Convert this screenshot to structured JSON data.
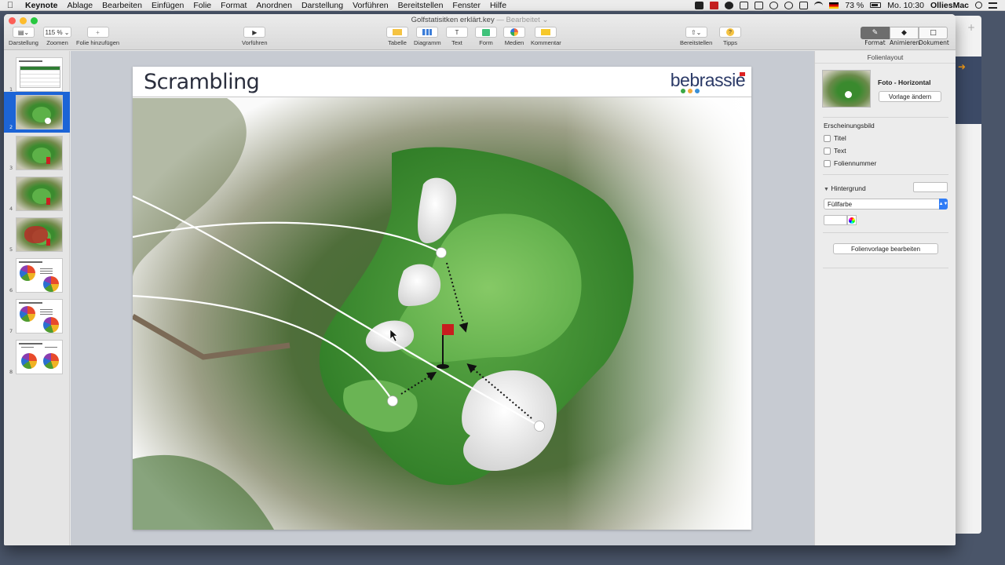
{
  "menubar": {
    "apple": "",
    "items": [
      "Keynote",
      "Ablage",
      "Bearbeiten",
      "Einfügen",
      "Folie",
      "Format",
      "Anordnen",
      "Darstellung",
      "Vorführen",
      "Bereitstellen",
      "Fenster",
      "Hilfe"
    ],
    "battery": "73 %",
    "clock": "Mo. 10:30",
    "user": "OlliesMac",
    "icons": [
      "dropbox-icon",
      "adobe-icon",
      "creative-cloud-icon",
      "cloud-upload-icon",
      "airplay-icon",
      "time-machine-icon",
      "sync-icon",
      "screen-icon",
      "wifi-icon",
      "flag-de-icon",
      "battery-icon",
      "search-icon",
      "list-icon"
    ]
  },
  "window": {
    "title": "Golfstatisitken erklärt.key",
    "status": "— Bearbeitet ⌄"
  },
  "toolbar": {
    "view": {
      "label": "Darstellung",
      "icon": "view-sidebar-icon"
    },
    "zoom": {
      "label": "Zoomen",
      "value": "115 %"
    },
    "add_slide": {
      "label": "Folie hinzufügen",
      "icon": "plus-icon"
    },
    "play": {
      "label": "Vorführen",
      "icon": "play-icon"
    },
    "insert": [
      {
        "label": "Tabelle",
        "icon": "table-icon",
        "color": "#f5c342"
      },
      {
        "label": "Diagramm",
        "icon": "chart-icon",
        "color": "#3b7dd8"
      },
      {
        "label": "Text",
        "icon": "text-icon",
        "glyph": "T"
      },
      {
        "label": "Form",
        "icon": "shape-icon",
        "color": "#3fc27a"
      },
      {
        "label": "Medien",
        "icon": "media-icon"
      },
      {
        "label": "Kommentar",
        "icon": "comment-icon",
        "color": "#f6c82b"
      }
    ],
    "share": {
      "label": "Bereitstellen",
      "icon": "share-icon"
    },
    "tips": {
      "label": "Tipps",
      "icon": "tips-icon",
      "glyph": "?"
    },
    "segments": [
      {
        "label": "Format",
        "icon": "paintbrush-icon",
        "active": true
      },
      {
        "label": "Animieren",
        "icon": "animate-icon",
        "active": false
      },
      {
        "label": "Dokument",
        "icon": "document-icon",
        "active": false
      }
    ]
  },
  "navigator": {
    "slides": [
      {
        "num": "1",
        "kind": "table"
      },
      {
        "num": "2",
        "kind": "golf",
        "selected": true
      },
      {
        "num": "3",
        "kind": "golf"
      },
      {
        "num": "4",
        "kind": "golf"
      },
      {
        "num": "5",
        "kind": "golf-red"
      },
      {
        "num": "6",
        "kind": "pies"
      },
      {
        "num": "7",
        "kind": "pies"
      },
      {
        "num": "8",
        "kind": "pies"
      }
    ]
  },
  "slide": {
    "title": "Scrambling",
    "brand": "bebrassie",
    "brand_dots": [
      "#3aa845",
      "#f2a93b",
      "#3a8fd6"
    ]
  },
  "inspector": {
    "header": "Folienlayout",
    "layout_name": "Foto - Horizontal",
    "change_template": "Vorlage ändern",
    "appearance": "Erscheinungsbild",
    "checkboxes": [
      "Titel",
      "Text",
      "Foliennummer"
    ],
    "background_section": "Hintergrund",
    "fill_option": "Füllfarbe",
    "edit_master": "Folienvorlage bearbeiten"
  }
}
